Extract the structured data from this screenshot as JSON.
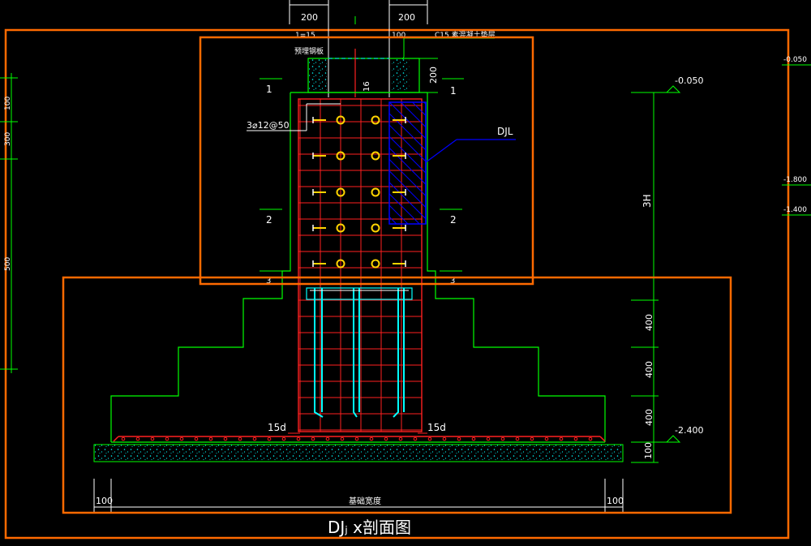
{
  "drawing": {
    "title": "DJⱼ x剖面图",
    "top_dims": [
      "200",
      "200"
    ],
    "top_note_left": "1=15",
    "top_note_right": "100",
    "top_note_concrete": "C15 素混凝土垫层",
    "plate_label": "预埋钢板",
    "plate_height": "200",
    "rebar_note": "3⌀12@50",
    "dim_marker": "16",
    "djl_label": "DJL",
    "section_marks": [
      "1",
      "1",
      "2",
      "2",
      "3",
      "3"
    ],
    "elev_top": "-0.050",
    "elev_bottom": "-2.400",
    "right_dims": [
      "3H",
      "400",
      "400",
      "400",
      "100"
    ],
    "left_dims": [
      "100",
      "300",
      "500"
    ],
    "edge_elevs": [
      "-0.050",
      "-1.800",
      "-1.400"
    ],
    "anchor_left": "15d",
    "anchor_right": "15d",
    "bottom_left": "100",
    "bottom_right": "100",
    "bottom_center": "基础宽度"
  },
  "colors": {
    "background": "#000000",
    "outline": "#00ff00",
    "rebar": "#ff2020",
    "bolt": "#ffd400",
    "dim": "#00ff00",
    "stirrup": "#00ffff",
    "hatch": "#0000ff",
    "highlight": "#ff6a00",
    "text": "#ffffff"
  }
}
